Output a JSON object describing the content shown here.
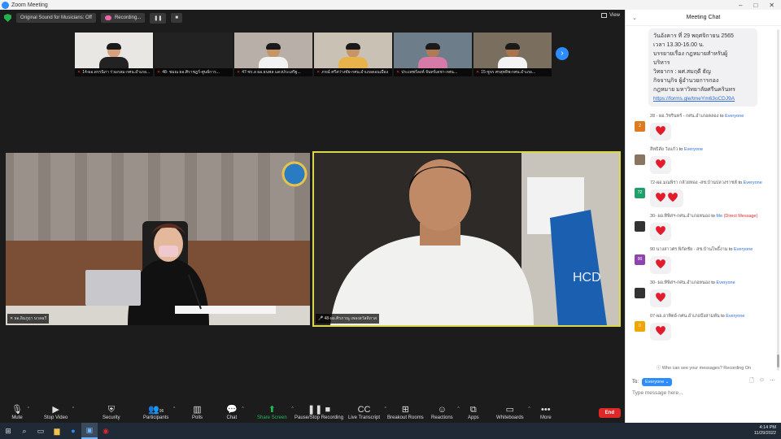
{
  "window": {
    "title": "Zoom Meeting"
  },
  "topbar": {
    "original_sound": "Original Sound for Musicians: Off",
    "recording": "Recording...",
    "view": "View"
  },
  "gallery": [
    {
      "name": "14-ผอ.ดรรนิภา ร่วมกลม-กศน.อำเภอ..."
    },
    {
      "name": "48- ชมณ ผอ.ศิราชฎร์-ศูนย์การ..."
    },
    {
      "name": "47-ชร.ล ผอ.ธนพล แดงประเสริฐ..."
    },
    {
      "name": "ภรณ์ ศรีสว่างชัย-กศน.อำเภอดอนเมือง"
    },
    {
      "name": "ประเพชร์ลงค์ จันทร์เดชา-กศน..."
    },
    {
      "name": "15-ชูจร ศรสุทธิพ-กศน.อำเภอ..."
    }
  ],
  "videos": {
    "left_label": "ผอ.อิมภูฤา นวลฉวี",
    "right_label": "48-ผอ.ศิรภาณู เพลงสวัสดิภาส"
  },
  "toolbar": {
    "mute": "Mute",
    "stop_video": "Stop Video",
    "security": "Security",
    "participants": "Participants",
    "participants_count": "96",
    "polls": "Polls",
    "chat": "Chat",
    "share_screen": "Share Screen",
    "pause_stop_recording": "Pause/Stop Recording",
    "live_transcript": "Live Transcript",
    "breakout_rooms": "Breakout Rooms",
    "reactions": "Reactions",
    "apps": "Apps",
    "whiteboards": "Whiteboards",
    "more": "More",
    "end": "End"
  },
  "chat": {
    "title": "Meeting Chat",
    "first_bubble": {
      "lines": [
        "วันอังคาร ที่ 29 พฤศจิกายน 2565",
        "เวลา 13.30-16.00 น.",
        "บรรยายเรื่อง กฎหมายสำหรับผู้",
        "บริหาร",
        "วิทยากร : ผศ.สมฤดี ธัญ",
        "กิจจานุกิจ ผู้อำนวยการกอง",
        "กฎหมาย มหาวิทยาลัยศรีนครินทร"
      ],
      "link": "https://forms.gle/tmeYm63oCDJ9A"
    },
    "messages": [
      {
        "sender": "28 - ผอ.วัชรินทร์ - กศน.อำเภอคลอง",
        "to": "to",
        "recipient": "Everyone",
        "avatar": "2",
        "avatar_color": "#e07a1f",
        "hearts": 1
      },
      {
        "sender": "สิทธิลัย วังแก้ว",
        "to": "to",
        "recipient": "Everyone",
        "avatar": "",
        "avatar_color": "#8a7560",
        "hearts": 1
      },
      {
        "sender": "72-ผอ.มณพิรา กล้วยทอง -สช.บ้านปลวงราชห์",
        "to": "to",
        "recipient": "Everyone",
        "avatar": "72",
        "avatar_color": "#22a06b",
        "hearts": 2
      },
      {
        "sender": "30- ผอ.ทิพิสฯ-กศน.อำเภอหนอง",
        "to": "to",
        "recipient": "Me",
        "direct": "(Direct Message)",
        "avatar": "",
        "avatar_color": "#333",
        "hearts": 1
      },
      {
        "sender": "90 นางสาวศร พิกัดชัย - สช.บ้านโพธิ์งาม",
        "to": "to",
        "recipient": "Everyone",
        "avatar": "90",
        "avatar_color": "#8e44ad",
        "hearts": 1
      },
      {
        "sender": "30- ผอ.ทิพิสฯ-กศน.อำเภอหนอง",
        "to": "to",
        "recipient": "Everyone",
        "avatar": "",
        "avatar_color": "#333",
        "hearts": 1
      },
      {
        "sender": "07-ผอ.อาทิตย์-กศน.อำเภอบึงสามพัน",
        "to": "to",
        "recipient": "Everyone",
        "avatar": "0",
        "avatar_color": "#f0a500",
        "hearts": 1
      }
    ],
    "who_can_see": "Who can see your messages? Recording On",
    "to_label": "To:",
    "to_value": "Everyone",
    "input_placeholder": "Type message here..."
  },
  "taskbar": {
    "time": "4:14 PM",
    "date": "11/29/2022"
  },
  "colors": {
    "accent": "#2d8cff",
    "share": "#1dbe5a",
    "end": "#e02828",
    "highlight": "#d8d84a"
  }
}
